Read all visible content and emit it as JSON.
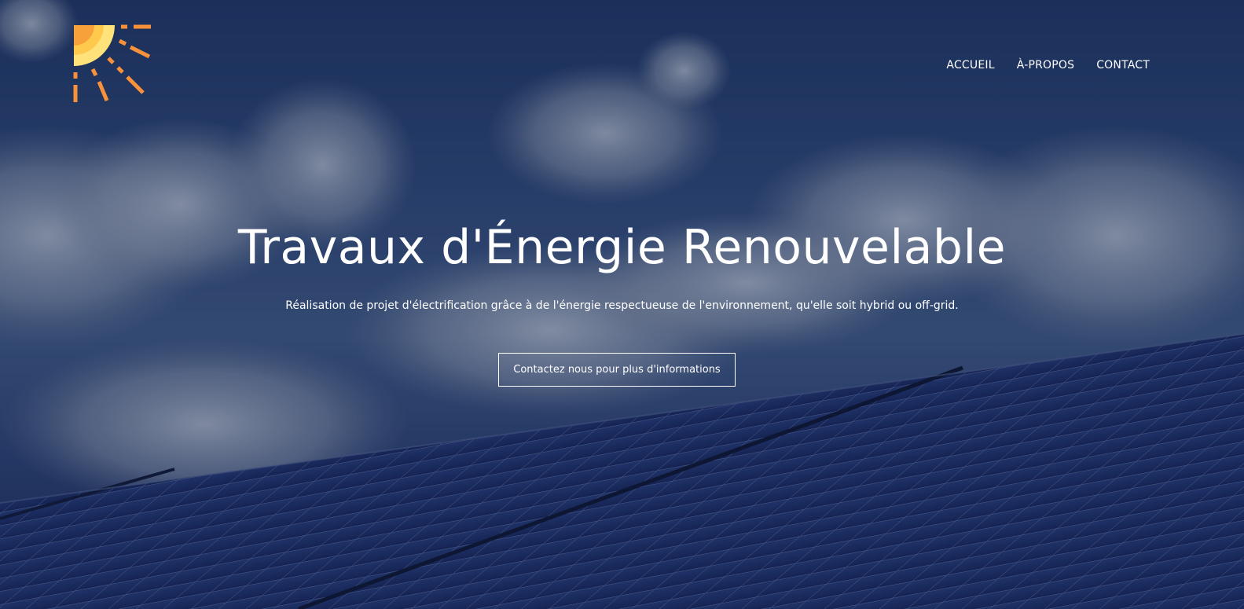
{
  "header": {
    "logo_icon": "sun-icon",
    "nav": [
      {
        "label": "ACCUEIL"
      },
      {
        "label": "À-PROPOS"
      },
      {
        "label": "CONTACT"
      }
    ]
  },
  "hero": {
    "title": "Travaux d'Énergie Renouvelable",
    "subtitle": "Réalisation de projet d'électrification grâce à de l'énergie respectueuse de l'environnement, qu'elle soit hybrid ou off-grid.",
    "cta_label": "Contactez nous pour plus d'informations"
  },
  "colors": {
    "sun_yellow": "#ffd966",
    "sun_orange": "#f29c38",
    "ray_orange": "#f7913a",
    "sky": "#2b4472",
    "panel": "#1b2d63"
  }
}
